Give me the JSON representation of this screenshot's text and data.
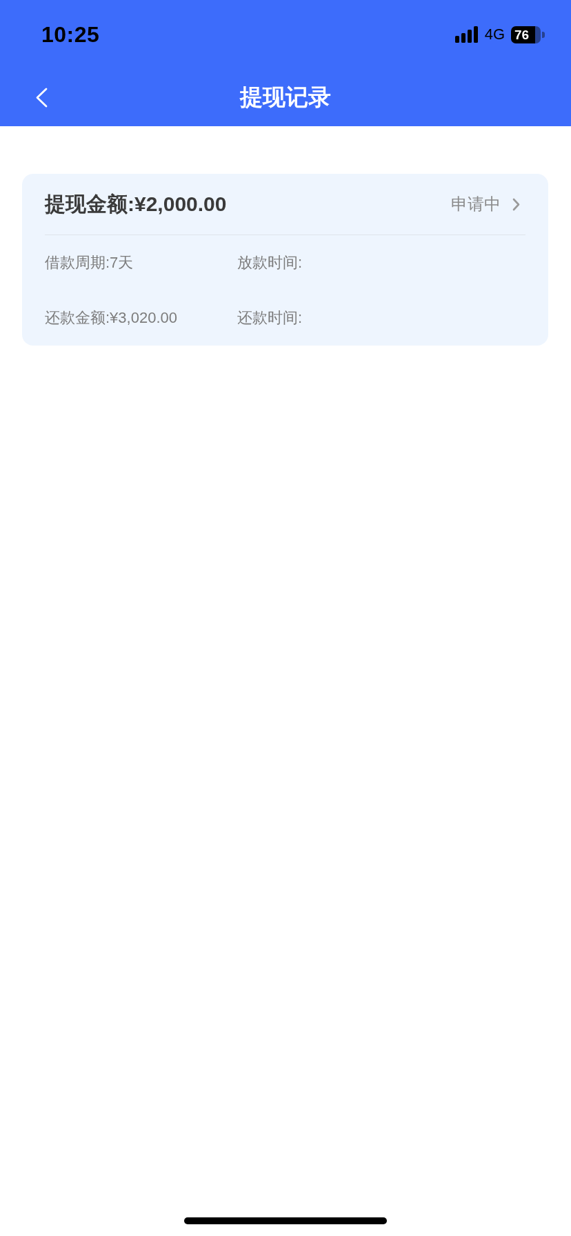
{
  "status_bar": {
    "time": "10:25",
    "network": "4G",
    "battery": "76"
  },
  "nav_bar": {
    "title": "提现记录"
  },
  "records": [
    {
      "title": "提现金额:¥2,000.00",
      "status": "申请中",
      "fields": [
        "借款周期:7天",
        "放款时间:",
        "还款金额:¥3,020.00",
        "还款时间:"
      ]
    }
  ]
}
